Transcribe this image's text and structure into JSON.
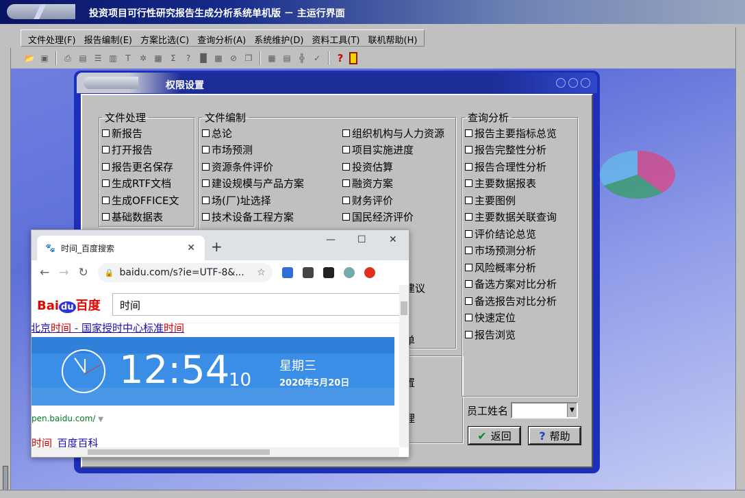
{
  "app": {
    "title": "投资项目可行性研究报告生成分析系统单机版 － 主运行界面",
    "menu": [
      "文件处理(F)",
      "报告编制(E)",
      "方案比选(C)",
      "查询分析(A)",
      "系统维护(D)",
      "资料工具(T)",
      "联机帮助(H)"
    ],
    "toolbar_icons": [
      "open-folder-icon",
      "save-icon",
      "print-icon",
      "document-icon",
      "list-icon",
      "report-icon",
      "text-icon",
      "chart-icon",
      "calculator-icon",
      "sum-icon",
      "formula-icon",
      "block-icon",
      "grid-icon",
      "stop-icon",
      "copy-icon",
      "table-icon",
      "form-icon",
      "tree-icon",
      "check-icon",
      "help-icon",
      "exit-icon"
    ]
  },
  "dialog": {
    "title": "权限设置",
    "groups": {
      "file": {
        "label": "文件处理",
        "items": [
          "新报告",
          "打开报告",
          "报告更名保存",
          "生成RTF文档",
          "生成OFFICE文",
          "基础数据表"
        ]
      },
      "edit": {
        "label": "文件编制",
        "col1": [
          "总论",
          "市场预测",
          "资源条件评价",
          "建设规模与产品方案",
          "场(厂)址选择",
          "技术设备工程方案"
        ],
        "col2": [
          "组织机构与人力资源",
          "项目实施进度",
          "投资估算",
          "融资方案",
          "财务评价",
          "国民经济评价"
        ],
        "col2_partial": [
          "建议",
          "单"
        ]
      },
      "query": {
        "label": "查询分析",
        "items": [
          "报告主要指标总览",
          "报告完整性分析",
          "报告合理性分析",
          "主要数据报表",
          "主要图例",
          "主要数据关联查询",
          "评价结论总览",
          "市场预测分析",
          "风险概率分析",
          "备选方案对比分析",
          "备选报告对比分析",
          "快速定位",
          "报告浏览"
        ]
      },
      "lower_partial": [
        "置",
        "理"
      ]
    },
    "employee_label": "员工姓名",
    "employee_value": "",
    "back_button": "返回",
    "help_button": "帮助"
  },
  "browser": {
    "tab_title": "时间_百度搜索",
    "url": "baidu.com/s?ie=UTF-8&...",
    "logo": {
      "bai": "Bai",
      "du": "du",
      "baidu": "百度"
    },
    "search_value": "时间",
    "top_link_pre": "北京",
    "top_link_hl": "时间",
    "top_link_mid": " - 国家授时中心标准",
    "top_link_hl2": "时间",
    "clock": {
      "time": "12:54",
      "seconds": "10",
      "weekday": "星期三",
      "date": "2020年5月20日"
    },
    "source_url": "pen.baidu.com/",
    "bottom_link_hl": "时间",
    "bottom_link_rest": "_百度百科"
  }
}
